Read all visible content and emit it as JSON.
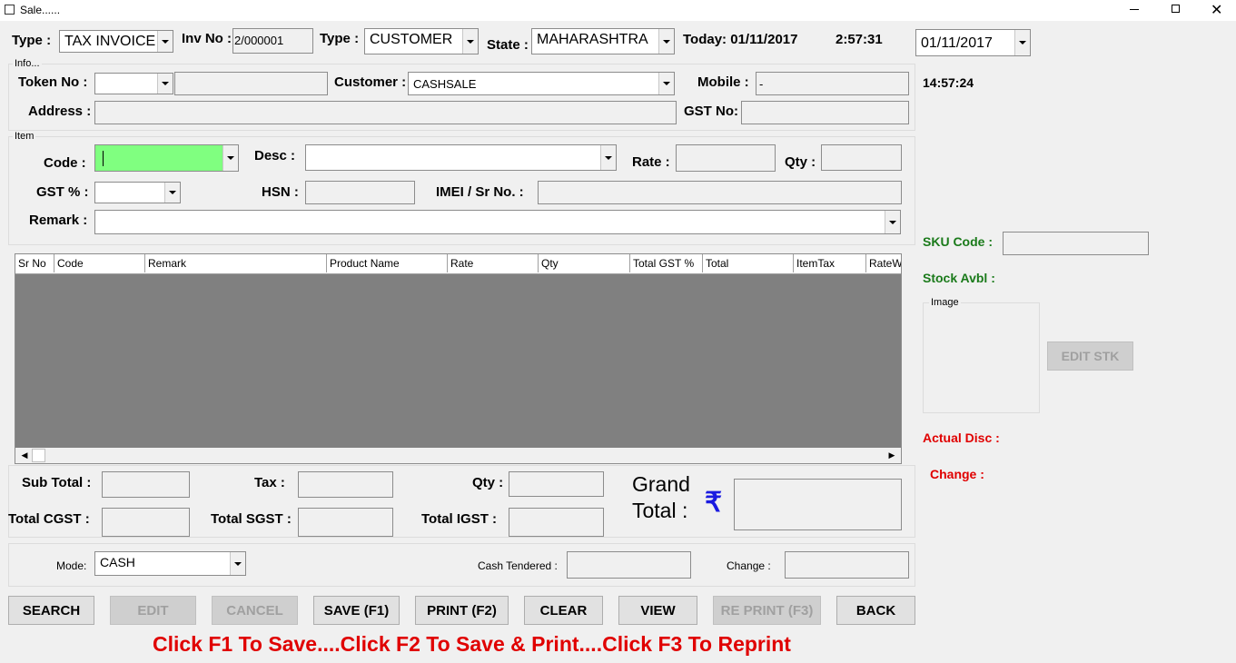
{
  "window": {
    "title": "Sale......"
  },
  "header": {
    "type_label": "Type :",
    "type_value": "TAX INVOICE",
    "inv_label": "Inv No :",
    "inv_value": "2/000001",
    "type2_label": "Type :",
    "type2_value": "CUSTOMER",
    "state_label": "State :",
    "state_value": "MAHARASHTRA",
    "today": "Today: 01/11/2017",
    "time": "2:57:31",
    "date_value": "01/11/2017",
    "clock": "14:57:24"
  },
  "info": {
    "title": "Info...",
    "token_label": "Token No :",
    "token_value": "",
    "token_text": "",
    "customer_label": "Customer :",
    "customer_value": "CASHSALE",
    "mobile_label": "Mobile :",
    "mobile_value": "-",
    "address_label": "Address :",
    "address_value": "",
    "gst_label": "GST No:",
    "gst_value": ""
  },
  "item": {
    "title": "Item",
    "code_label": "Code :",
    "code_value": "",
    "desc_label": "Desc :",
    "desc_value": "",
    "rate_label": "Rate :",
    "rate_value": "",
    "qty_label": "Qty :",
    "qty_value": "",
    "gst_label": "GST % :",
    "gst_value": "",
    "hsn_label": "HSN :",
    "hsn_value": "",
    "imei_label": "IMEI / Sr No. :",
    "imei_value": "",
    "remark_label": "Remark :",
    "remark_value": ""
  },
  "grid": {
    "columns": [
      "Sr No",
      "Code",
      "Remark",
      "Product Name",
      "Rate",
      "Qty",
      "Total GST %",
      "Total",
      "ItemTax",
      "RateW"
    ]
  },
  "totals": {
    "subtotal_label": "Sub Total :",
    "tax_label": "Tax :",
    "qty_label": "Qty :",
    "cgst_label": "Total CGST :",
    "sgst_label": "Total SGST :",
    "igst_label": "Total IGST :",
    "grand_label_1": "Grand",
    "grand_label_2": "Total :",
    "currency_symbol": "₹"
  },
  "payment": {
    "mode_label": "Mode:",
    "mode_value": "CASH",
    "tendered_label": "Cash Tendered :",
    "change_label": "Change :"
  },
  "buttons": {
    "search": "SEARCH",
    "edit": "EDIT",
    "cancel": "CANCEL",
    "save": "SAVE (F1)",
    "print": "PRINT (F2)",
    "clear": "CLEAR",
    "view": "VIEW",
    "reprint": "RE PRINT (F3)",
    "back": "BACK"
  },
  "side": {
    "sku_label": "SKU Code :",
    "stock_label": "Stock Avbl :",
    "image_title": "Image",
    "edit_stk": "EDIT STK",
    "actual_disc": "Actual Disc :",
    "change": "Change :"
  },
  "footer": {
    "hint": "Click F1 To Save....Click F2 To Save & Print....Click F3 To Reprint"
  },
  "colors": {
    "accent_red": "#e00000",
    "green": "#1a7a1a",
    "code_field": "#80ff80",
    "rupee": "#1a1ae0"
  }
}
